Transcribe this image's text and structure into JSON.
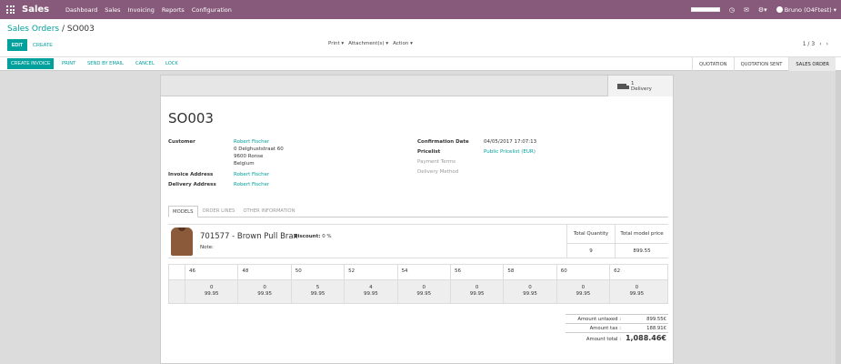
{
  "navbar": {
    "brand": "Sales",
    "menu": [
      "Dashboard",
      "Sales",
      "Invoicing",
      "Reports",
      "Configuration"
    ],
    "user": "Bruno (O4Ftest)"
  },
  "control_panel": {
    "breadcrumb_parent": "Sales Orders",
    "breadcrumb_sep": "/",
    "breadcrumb_current": "SO003",
    "edit_label": "EDIT",
    "create_label": "CREATE",
    "print_label": "Print ▾",
    "attachments_label": "Attachment(s) ▾",
    "action_label": "Action ▾",
    "pager_value": "1 / 3",
    "prev_glyph": "‹",
    "next_glyph": "›"
  },
  "statusbar": {
    "buttons": [
      "CREATE INVOICE",
      "PRINT",
      "SEND BY EMAIL",
      "CANCEL",
      "LOCK"
    ],
    "stages": [
      "QUOTATION",
      "QUOTATION SENT",
      "SALES ORDER"
    ],
    "active_stage": "SALES ORDER"
  },
  "form": {
    "smart_button": {
      "count": "1",
      "label": "Delivery"
    },
    "title": "SO003",
    "customer_label": "Customer",
    "customer_name": "Robert Fischer",
    "customer_addr1": "0 Delghuststraat 60",
    "customer_addr2": "9600 Ronse",
    "customer_addr3": "Belgium",
    "invoice_address_label": "Invoice Address",
    "invoice_address": "Robert Fischer",
    "delivery_address_label": "Delivery Address",
    "delivery_address": "Robert Fischer",
    "confirmation_date_label": "Confirmation Date",
    "confirmation_date": "04/05/2017 17:07:13",
    "pricelist_label": "Pricelist",
    "pricelist": "Public Pricelist (EUR)",
    "payment_terms_label": "Payment Terms",
    "delivery_method_label": "Delivery Method",
    "tabs": [
      "MODELS",
      "ORDER LINES",
      "OTHER INFORMATION"
    ]
  },
  "product": {
    "name": "701577 - Brown Pull Brax",
    "discount_label": "Discount:",
    "discount_value": "0 %",
    "note_label": "Note:",
    "total_qty_label": "Total Quantity",
    "total_price_label": "Total model price",
    "total_qty": "9",
    "total_price": "899.55",
    "sizes": [
      "46",
      "48",
      "50",
      "52",
      "54",
      "56",
      "58",
      "60",
      "62"
    ],
    "quantities": [
      "0",
      "0",
      "5",
      "4",
      "0",
      "0",
      "0",
      "0",
      "0"
    ],
    "prices": [
      "99.95",
      "99.95",
      "99.95",
      "99.95",
      "99.95",
      "99.95",
      "99.95",
      "99.95",
      "99.95"
    ]
  },
  "totals": {
    "untaxed_label": "Amount untaxed :",
    "untaxed": "899.55€",
    "tax_label": "Amount tax :",
    "tax": "188.91€",
    "total_label": "Amount total :",
    "total": "1,088.46€"
  },
  "colors": {
    "navbar": "#875a7b",
    "accent": "#00a09d"
  }
}
